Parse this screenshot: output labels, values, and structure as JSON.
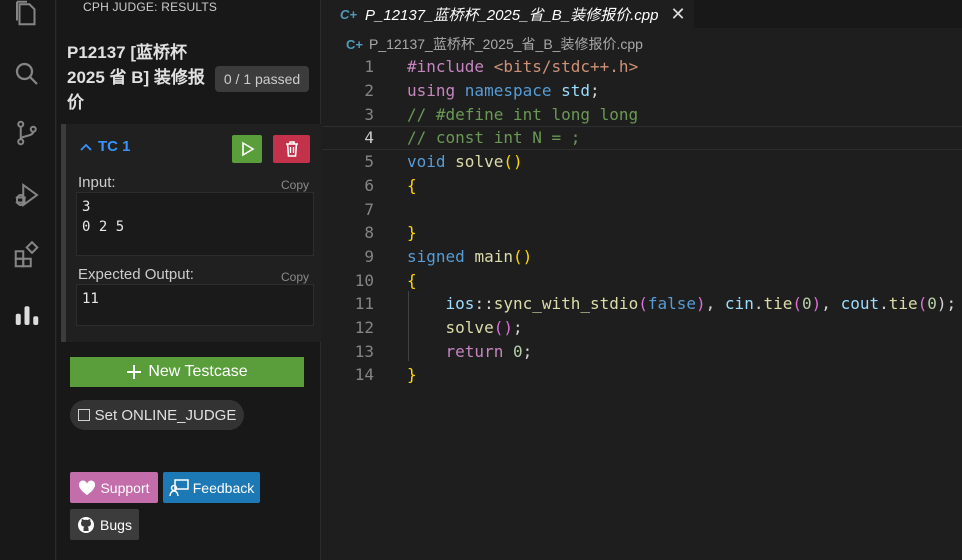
{
  "panel": {
    "header": "CPH JUDGE: RESULTS",
    "problem_title": "P12137 [蓝桥杯 2025 省 B] 装修报价",
    "passed": "0 / 1 passed"
  },
  "testcase": {
    "label": "TC 1",
    "input_label": "Input:",
    "copy_label": "Copy",
    "input_value": "3\n0 2 5",
    "expected_label": "Expected Output:",
    "expected_value": "11"
  },
  "buttons": {
    "new_testcase": "New Testcase",
    "online_judge": "Set ONLINE_JUDGE",
    "support": "Support",
    "feedback": "Feedback",
    "bugs": "Bugs"
  },
  "editor": {
    "tab_title": "P_12137_蓝桥杯_2025_省_B_装修报价.cpp",
    "breadcrumb": "P_12137_蓝桥杯_2025_省_B_装修报价.cpp",
    "current_line": 4,
    "lines": [
      {
        "n": "1",
        "tokens": [
          {
            "t": "#include ",
            "c": "ctrl"
          },
          {
            "t": "<bits/stdc++.h>",
            "c": "str"
          }
        ]
      },
      {
        "n": "2",
        "tokens": [
          {
            "t": "using ",
            "c": "ctrl"
          },
          {
            "t": "namespace ",
            "c": "kw"
          },
          {
            "t": "std",
            "c": "var"
          },
          {
            "t": ";",
            "c": "plain"
          }
        ]
      },
      {
        "n": "3",
        "tokens": [
          {
            "t": "// #define int long long",
            "c": "cmt"
          }
        ]
      },
      {
        "n": "4",
        "tokens": [
          {
            "t": "// const int N = ;",
            "c": "cmt"
          }
        ]
      },
      {
        "n": "5",
        "tokens": [
          {
            "t": "void ",
            "c": "kw"
          },
          {
            "t": "solve",
            "c": "fn"
          },
          {
            "t": "()",
            "c": "brace"
          }
        ]
      },
      {
        "n": "6",
        "tokens": [
          {
            "t": "{",
            "c": "brace"
          }
        ]
      },
      {
        "n": "7",
        "tokens": []
      },
      {
        "n": "8",
        "tokens": [
          {
            "t": "}",
            "c": "brace"
          }
        ]
      },
      {
        "n": "9",
        "tokens": [
          {
            "t": "signed ",
            "c": "kw"
          },
          {
            "t": "main",
            "c": "fn"
          },
          {
            "t": "()",
            "c": "brace"
          }
        ]
      },
      {
        "n": "10",
        "tokens": [
          {
            "t": "{",
            "c": "brace"
          }
        ]
      },
      {
        "n": "11",
        "tokens": [
          {
            "t": "    ",
            "c": "plain"
          },
          {
            "t": "ios",
            "c": "var"
          },
          {
            "t": "::",
            "c": "plain"
          },
          {
            "t": "sync_with_stdio",
            "c": "fn"
          },
          {
            "t": "(",
            "c": "paren"
          },
          {
            "t": "false",
            "c": "kw"
          },
          {
            "t": ")",
            "c": "paren"
          },
          {
            "t": ", ",
            "c": "plain"
          },
          {
            "t": "cin",
            "c": "var"
          },
          {
            "t": ".",
            "c": "plain"
          },
          {
            "t": "tie",
            "c": "fn"
          },
          {
            "t": "(",
            "c": "paren"
          },
          {
            "t": "0",
            "c": "num"
          },
          {
            "t": ")",
            "c": "paren"
          },
          {
            "t": ", ",
            "c": "plain"
          },
          {
            "t": "cout",
            "c": "var"
          },
          {
            "t": ".",
            "c": "plain"
          },
          {
            "t": "tie",
            "c": "fn"
          },
          {
            "t": "(",
            "c": "paren"
          },
          {
            "t": "0",
            "c": "num"
          },
          {
            "t": ");",
            "c": "plain"
          }
        ]
      },
      {
        "n": "12",
        "tokens": [
          {
            "t": "    ",
            "c": "plain"
          },
          {
            "t": "solve",
            "c": "fn"
          },
          {
            "t": "()",
            "c": "paren"
          },
          {
            "t": ";",
            "c": "plain"
          }
        ]
      },
      {
        "n": "13",
        "tokens": [
          {
            "t": "    ",
            "c": "plain"
          },
          {
            "t": "return ",
            "c": "ctrl"
          },
          {
            "t": "0",
            "c": "num"
          },
          {
            "t": ";",
            "c": "plain"
          }
        ]
      },
      {
        "n": "14",
        "tokens": [
          {
            "t": "}",
            "c": "brace"
          }
        ]
      }
    ]
  },
  "colors": {
    "run_button": "#5a9e3c",
    "delete_button": "#c4314b",
    "support_button": "#c36dab",
    "feedback_button": "#1d79b5",
    "accent": "#3794ff"
  },
  "icons": {
    "activity": [
      "explorer-icon",
      "search-icon",
      "source-control-icon",
      "run-debug-icon",
      "extensions-icon",
      "cph-judge-icon"
    ],
    "run": "play-icon",
    "delete": "trash-icon"
  }
}
